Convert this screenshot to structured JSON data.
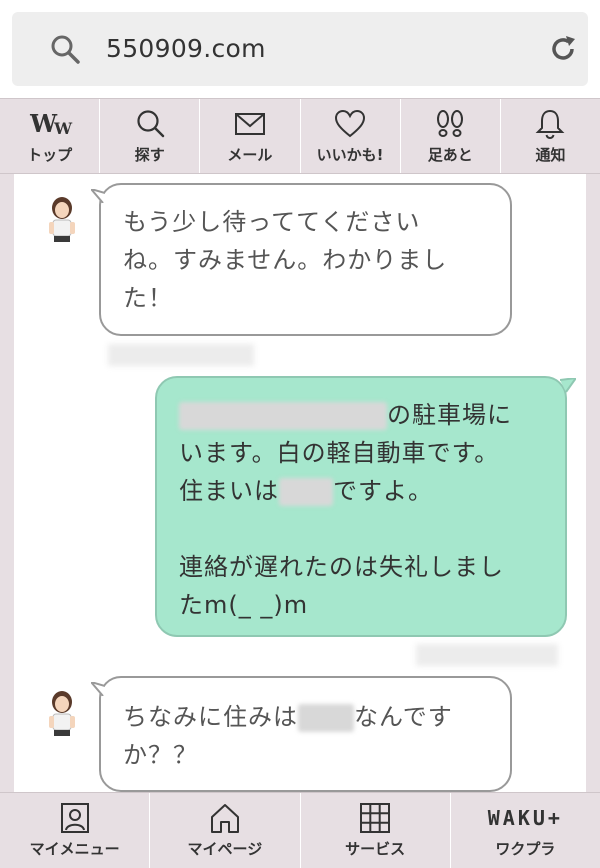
{
  "browser": {
    "url": "550909.com"
  },
  "topnav": {
    "items": [
      {
        "label": "トップ",
        "icon": "ww-logo-icon"
      },
      {
        "label": "探す",
        "icon": "search-icon"
      },
      {
        "label": "メール",
        "icon": "mail-icon"
      },
      {
        "label": "いいかも!",
        "icon": "heart-icon"
      },
      {
        "label": "足あと",
        "icon": "footprints-icon"
      },
      {
        "label": "通知",
        "icon": "bell-icon"
      }
    ],
    "logo_text": "W",
    "logo_text_small": "W"
  },
  "messages": [
    {
      "direction": "incoming",
      "lines": [
        "もう少し待っててください",
        "ね。すみません。わかりまし",
        "た！"
      ]
    },
    {
      "direction": "outgoing",
      "line1_suffix": "の駐車場に",
      "line2": "います。白の軽自動車です。",
      "line3_prefix": "住まいは",
      "line3_suffix": "ですよ。",
      "line4": "連絡が遅れたのは失礼しまし",
      "line5": "たm(_ _)m"
    },
    {
      "direction": "incoming",
      "line1_prefix": "ちなみに住みは",
      "line1_suffix": "なんです",
      "line2": "か？？"
    }
  ],
  "bottomnav": {
    "items": [
      {
        "label": "マイメニュー",
        "icon": "profile-icon"
      },
      {
        "label": "マイページ",
        "icon": "home-icon"
      },
      {
        "label": "サービス",
        "icon": "grid-icon"
      },
      {
        "label": "ワクプラ",
        "icon": "waku-plus-icon"
      }
    ],
    "waku_logo": "WAKU+"
  },
  "colors": {
    "nav_bg": "#e7dfe3",
    "outgoing_bubble": "#a6e7cd",
    "incoming_bubble": "#ffffff",
    "url_bar_bg": "#eeeeee"
  }
}
